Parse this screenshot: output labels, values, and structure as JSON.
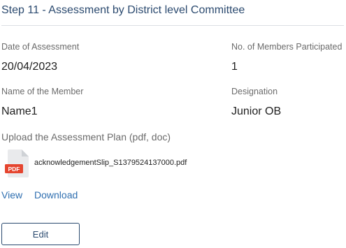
{
  "section": {
    "title": "Step 11 - Assessment by District level Committee"
  },
  "fields": {
    "date_label": "Date of Assessment",
    "date_value": "20/04/2023",
    "members_label": "No. of Members Participated",
    "members_value": "1",
    "member_name_label": "Name of the Member",
    "member_name_value": "Name1",
    "designation_label": "Designation",
    "designation_value": "Junior OB"
  },
  "upload": {
    "label": "Upload the Assessment Plan (pdf, doc)",
    "file_icon": "pdf-file-icon",
    "file_icon_text": "PDF",
    "file_name": "acknowledgementSlip_S1379524137000.pdf",
    "view_label": "View",
    "download_label": "Download"
  },
  "actions": {
    "edit_label": "Edit"
  },
  "colors": {
    "title": "#2b4a6f",
    "link": "#2f6fb0",
    "pdf_badge": "#e5452f"
  }
}
